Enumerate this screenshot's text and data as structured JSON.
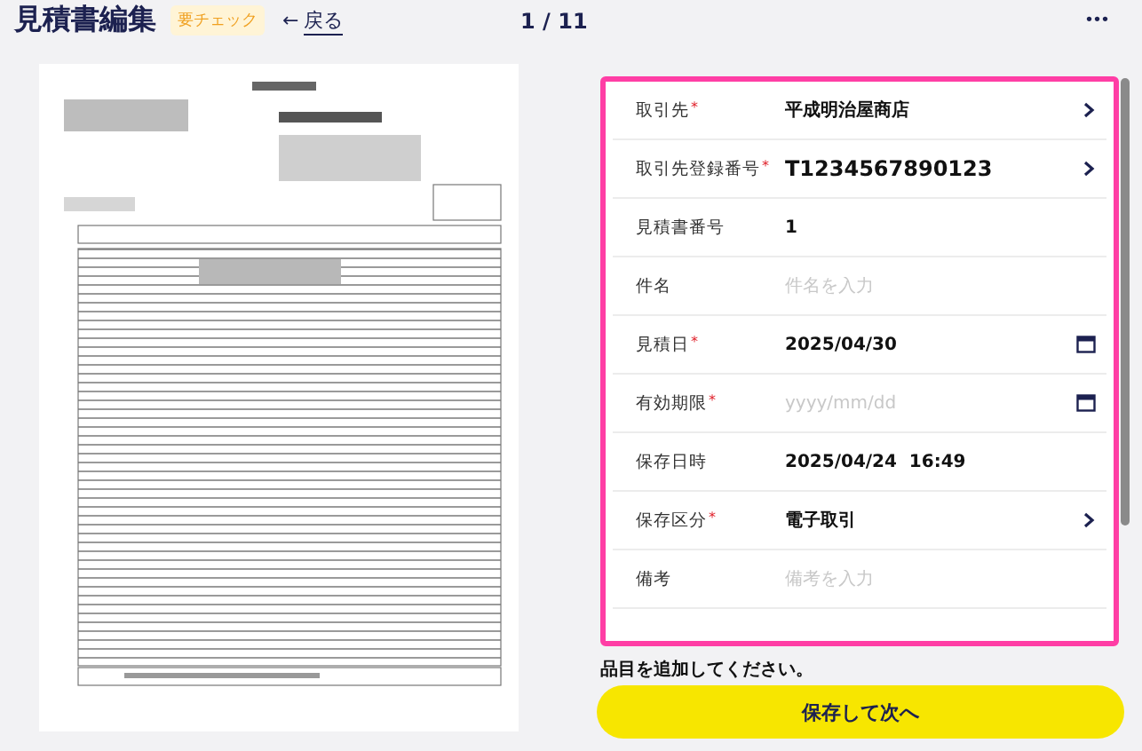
{
  "header": {
    "title": "見積書編集",
    "badge": "要チェック",
    "back_link": {
      "arrow": "←",
      "label": "戻る"
    },
    "pager": "1 / 11",
    "more": "•••"
  },
  "form": {
    "required_mark": "*",
    "fields": [
      {
        "kind": "select",
        "label": "取引先",
        "required": true,
        "value": "平成明治屋商店"
      },
      {
        "kind": "select",
        "label": "取引先登録番号",
        "required": true,
        "value": "T1234567890123"
      },
      {
        "kind": "text",
        "label": "見積書番号",
        "required": false,
        "value": "1"
      },
      {
        "kind": "input",
        "label": "件名",
        "required": false,
        "placeholder": "件名を入力"
      },
      {
        "kind": "date",
        "label": "見積日",
        "required": true,
        "value": "2025/04/30"
      },
      {
        "kind": "date",
        "label": "有効期限",
        "required": true,
        "placeholder": "yyyy/mm/dd"
      },
      {
        "kind": "text",
        "label": "保存日時",
        "required": false,
        "value": "2025/04/24  16:49"
      },
      {
        "kind": "select",
        "label": "保存区分",
        "required": true,
        "value": "電子取引"
      },
      {
        "kind": "input",
        "label": "備考",
        "required": false,
        "placeholder": "備考を入力"
      }
    ]
  },
  "notice": "品目を追加してください。",
  "primary_button": "保存して次へ"
}
